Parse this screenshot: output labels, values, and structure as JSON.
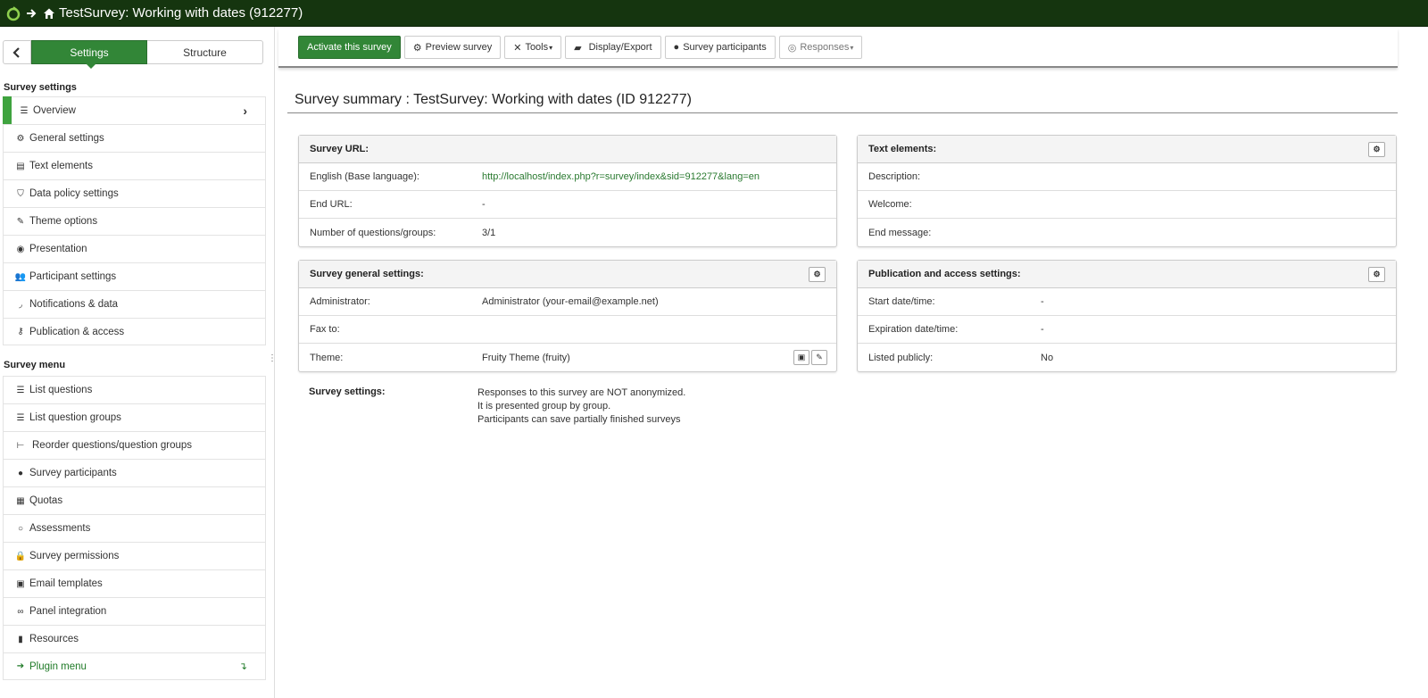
{
  "topbar": {
    "title": "TestSurvey: Working with dates (912277)"
  },
  "sidebar": {
    "tabs": {
      "settings": "Settings",
      "structure": "Structure"
    },
    "survey_settings_heading": "Survey settings",
    "survey_settings_items": [
      {
        "label": "Overview",
        "icon": "list-icon",
        "active": true
      },
      {
        "label": "General settings",
        "icon": "cogs-icon"
      },
      {
        "label": "Text elements",
        "icon": "file-text-icon"
      },
      {
        "label": "Data policy settings",
        "icon": "shield-icon"
      },
      {
        "label": "Theme options",
        "icon": "paint-brush-icon"
      },
      {
        "label": "Presentation",
        "icon": "eye-slash-icon"
      },
      {
        "label": "Participant settings",
        "icon": "users-icon"
      },
      {
        "label": "Notifications & data",
        "icon": "rss-icon"
      },
      {
        "label": "Publication & access",
        "icon": "key-icon"
      }
    ],
    "survey_menu_heading": "Survey menu",
    "survey_menu_items": [
      {
        "label": "List questions",
        "icon": "list-icon"
      },
      {
        "label": "List question groups",
        "icon": "list-icon"
      },
      {
        "label": "Reorder questions/question groups",
        "icon": "sitemap-icon"
      },
      {
        "label": "Survey participants",
        "icon": "user-icon"
      },
      {
        "label": "Quotas",
        "icon": "tasks-icon"
      },
      {
        "label": "Assessments",
        "icon": "comment-icon"
      },
      {
        "label": "Survey permissions",
        "icon": "lock-icon"
      },
      {
        "label": "Email templates",
        "icon": "envelope-square-icon"
      },
      {
        "label": "Panel integration",
        "icon": "link-icon"
      },
      {
        "label": "Resources",
        "icon": "file-icon"
      },
      {
        "label": "Plugin menu",
        "icon": "arrow-right-icon"
      }
    ]
  },
  "toolbar": {
    "activate": "Activate this survey",
    "preview": "Preview survey",
    "tools": "Tools",
    "display_export": "Display/Export",
    "participants": "Survey participants",
    "responses": "Responses"
  },
  "main": {
    "page_title": "Survey summary : TestSurvey: Working with dates (ID 912277)",
    "survey_url": {
      "heading": "Survey URL:",
      "rows": [
        {
          "label": "English (Base language):",
          "value": "http://localhost/index.php?r=survey/index&sid=912277&lang=en"
        },
        {
          "label": "End URL:",
          "value": "-"
        },
        {
          "label": "Number of questions/groups:",
          "value": "3/1"
        }
      ]
    },
    "text_elements": {
      "heading": "Text elements:",
      "rows": [
        {
          "label": "Description:",
          "value": ""
        },
        {
          "label": "Welcome:",
          "value": ""
        },
        {
          "label": "End message:",
          "value": ""
        }
      ]
    },
    "general_settings": {
      "heading": "Survey general settings:",
      "rows": [
        {
          "label": "Administrator:",
          "value": "Administrator (your-email@example.net)"
        },
        {
          "label": "Fax to:",
          "value": ""
        },
        {
          "label": "Theme:",
          "value": "Fruity Theme (fruity)"
        }
      ]
    },
    "publication": {
      "heading": "Publication and access settings:",
      "rows": [
        {
          "label": "Start date/time:",
          "value": "-"
        },
        {
          "label": "Expiration date/time:",
          "value": "-"
        },
        {
          "label": "Listed publicly:",
          "value": "No"
        }
      ]
    },
    "survey_settings": {
      "label": "Survey settings:",
      "lines": [
        "Responses to this survey are NOT anonymized.",
        "It is presented group by group.",
        "Participants can save partially finished surveys"
      ]
    }
  },
  "colors": {
    "topbar": "#15350f",
    "accent_green": "#328637",
    "active_bar": "#3fa33f",
    "link_green": "#2a7a30"
  }
}
